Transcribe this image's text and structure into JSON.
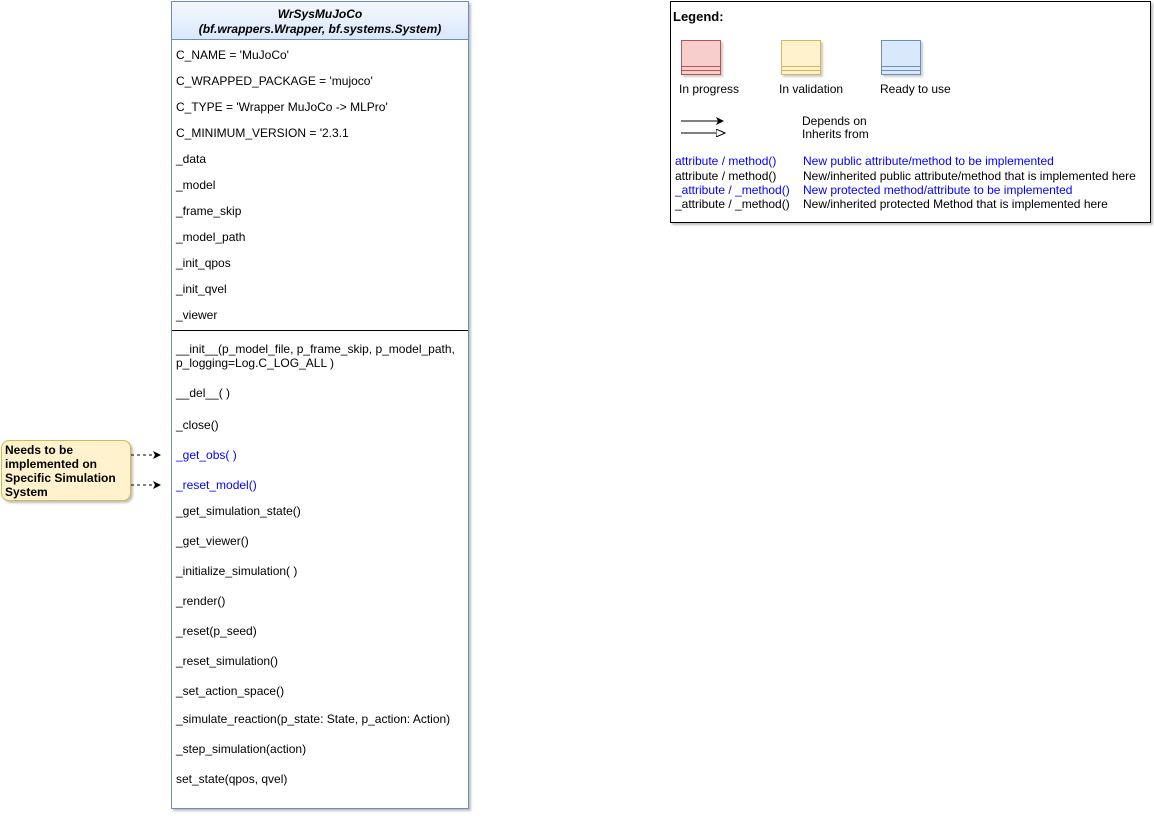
{
  "uml_class": {
    "name": "WrSysMuJoCo",
    "bases": "(bf.wrappers.Wrapper, bf.systems.System)",
    "attributes": [
      {
        "text": "C_NAME = 'MuJoCo'",
        "style": "black"
      },
      {
        "text": "C_WRAPPED_PACKAGE = 'mujoco'",
        "style": "black"
      },
      {
        "text": "C_TYPE = 'Wrapper MuJoCo -> MLPro'",
        "style": "black"
      },
      {
        "text": "C_MINIMUM_VERSION = '2.3.1",
        "style": "black"
      },
      {
        "text": "_data",
        "style": "black"
      },
      {
        "text": "_model",
        "style": "black"
      },
      {
        "text": "_frame_skip",
        "style": "black"
      },
      {
        "text": "_model_path",
        "style": "black"
      },
      {
        "text": "_init_qpos",
        "style": "black"
      },
      {
        "text": "_init_qvel",
        "style": "black"
      },
      {
        "text": "_viewer",
        "style": "black"
      }
    ],
    "methods": [
      {
        "text": "__init__(p_model_file, p_frame_skip, p_model_path,",
        "style": "black"
      },
      {
        "text": " p_logging=Log.C_LOG_ALL )",
        "style": "black"
      },
      {
        "text": "__del__( )",
        "style": "black"
      },
      {
        "text": "_close()",
        "style": "black"
      },
      {
        "text": "_get_obs( )",
        "style": "blue"
      },
      {
        "text": "_reset_model()",
        "style": "blue"
      },
      {
        "text": "_get_simulation_state()",
        "style": "black"
      },
      {
        "text": "_get_viewer()",
        "style": "black"
      },
      {
        "text": "_initialize_simulation( )",
        "style": "black"
      },
      {
        "text": "_render()",
        "style": "black"
      },
      {
        "text": "_reset(p_seed)",
        "style": "black"
      },
      {
        "text": "_reset_simulation()",
        "style": "black"
      },
      {
        "text": "_set_action_space()",
        "style": "black"
      },
      {
        "text": "_simulate_reaction(p_state: State, p_action: Action)",
        "style": "black"
      },
      {
        "text": "_step_simulation(action)",
        "style": "black"
      },
      {
        "text": "set_state(qpos, qvel)",
        "style": "black"
      }
    ]
  },
  "note": {
    "text_lines": [
      "Needs to be",
      "implemented on",
      "Specific Simulation",
      "System"
    ]
  },
  "legend": {
    "title": "Legend:",
    "status": [
      {
        "label": "In progress",
        "fill": "#f8cecc",
        "stroke": "#b85450"
      },
      {
        "label": "In validation",
        "fill": "#fff2cc",
        "stroke": "#d6b656"
      },
      {
        "label": "Ready to use",
        "fill": "#dae8fc",
        "stroke": "#6c8ebf"
      }
    ],
    "arrows": {
      "depends_on": "Depends on",
      "inherits_from": "Inherits from"
    },
    "conventions": [
      {
        "sample": "attribute / method()",
        "description": "New public attribute/method to be implemented",
        "color": "#0000ff"
      },
      {
        "sample": "attribute / method()",
        "description": "New/inherited public attribute/method that is implemented here",
        "color": "#000000"
      },
      {
        "sample": "_attribute / _method()",
        "description": "New protected method/attribute to be implemented",
        "color": "#0000ff"
      },
      {
        "sample": "_attribute / _method()",
        "description": "New/inherited protected Method that is implemented here",
        "color": "#000000"
      }
    ]
  },
  "colors": {
    "class_border": "#6c8ebf",
    "class_header": "#dae8fc",
    "note_fill": "#fff2cc",
    "note_stroke": "#d6b656",
    "highlight_text": "#0000ff"
  }
}
